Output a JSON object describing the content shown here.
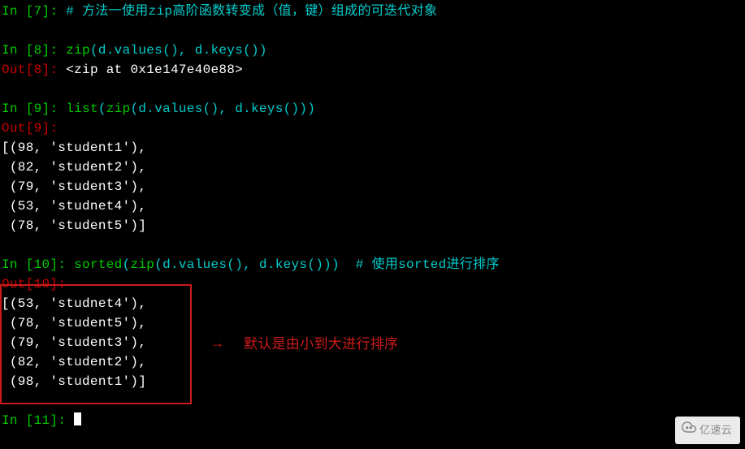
{
  "cells": {
    "c7": {
      "in_label": "In ",
      "in_num": "[7]",
      "prompt_sep": ": ",
      "comment": "# 方法一使用zip高阶函数转变成（值，键）组成的可迭代对象"
    },
    "c8": {
      "in_label": "In ",
      "in_num": "[8]",
      "prompt_sep": ": ",
      "code_a": "zip",
      "code_b": "(d.values(), d.keys())",
      "out_label": "Out",
      "out_num": "[8]",
      "result": "<zip at 0x1e147e40e88>"
    },
    "c9": {
      "in_label": "In ",
      "in_num": "[9]",
      "prompt_sep": ": ",
      "code_a": "list",
      "code_b": "(",
      "code_c": "zip",
      "code_d": "(d.values(), d.keys()))",
      "out_label": "Out",
      "out_num": "[9]",
      "out_sep": ":",
      "r1": "[(98, 'student1'),",
      "r2": " (82, 'student2'),",
      "r3": " (79, 'student3'),",
      "r4": " (53, 'studnet4'),",
      "r5": " (78, 'student5')]"
    },
    "c10": {
      "in_label": "In ",
      "in_num": "[10]",
      "prompt_sep": ": ",
      "code_a": "sorted",
      "code_b": "(",
      "code_c": "zip",
      "code_d": "(d.values(), d.keys()))  ",
      "comment": "# 使用sorted进行排序",
      "out_label": "Out",
      "out_num": "[10]",
      "out_sep": ":",
      "r1": "[(53, 'studnet4'),",
      "r2": " (78, 'student5'),",
      "r3": " (79, 'student3'),",
      "r4": " (82, 'student2'),",
      "r5": " (98, 'student1')]"
    },
    "c11": {
      "in_label": "In ",
      "in_num": "[11]",
      "prompt_sep": ": "
    }
  },
  "annotation": {
    "arrow": "→",
    "text": "默认是由小到大进行排序"
  },
  "watermark": {
    "text": "亿速云"
  }
}
